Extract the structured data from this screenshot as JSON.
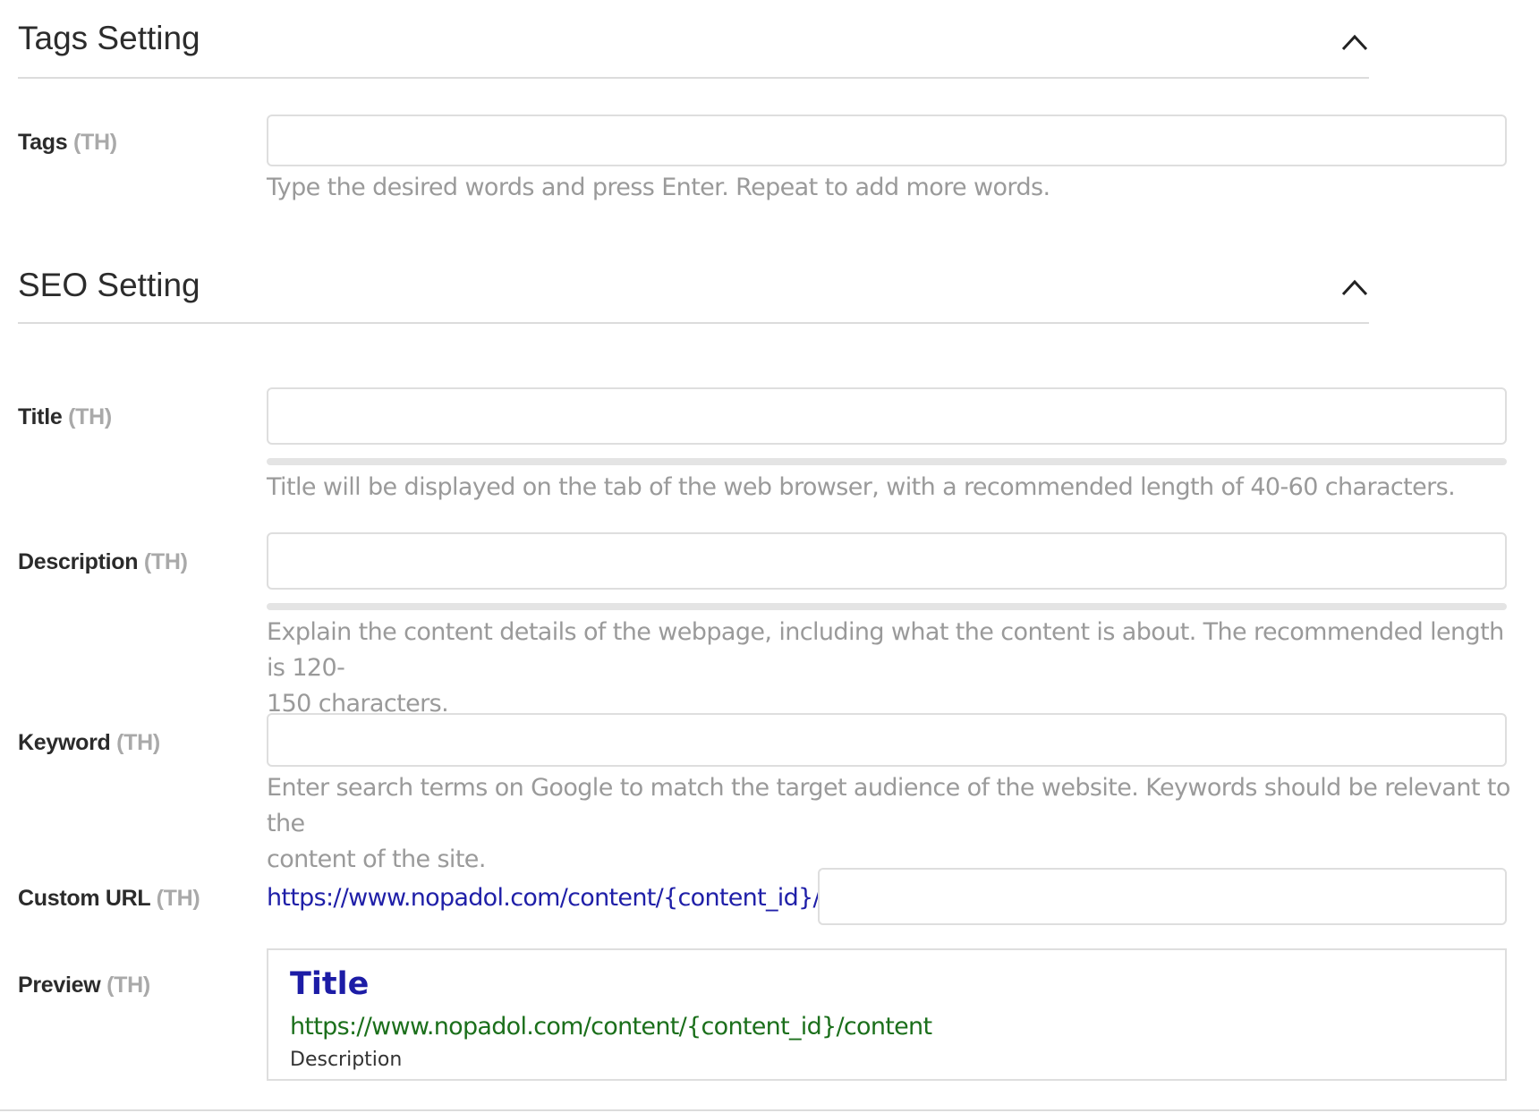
{
  "tags_section": {
    "title": "Tags Setting",
    "collapse_icon": "chevron-up-icon",
    "tags": {
      "label": "Tags",
      "lang": "(TH)",
      "value": "",
      "help": "Type the desired words and press Enter. Repeat to add more words."
    }
  },
  "seo_section": {
    "title": "SEO Setting",
    "collapse_icon": "chevron-up-icon",
    "title_field": {
      "label": "Title",
      "lang": "(TH)",
      "value": "",
      "help": "Title will be displayed on the tab of the web browser, with a recommended length of 40-60 characters."
    },
    "description_field": {
      "label": "Description",
      "lang": "(TH)",
      "value": "",
      "help_line1": "Explain the content details of the webpage, including what the content is about. The recommended length is 120-",
      "help_line2": "150 characters."
    },
    "keyword_field": {
      "label": "Keyword",
      "lang": "(TH)",
      "value": "",
      "help_line1": "Enter search terms on Google to match the target audience of the website. Keywords should be relevant to the",
      "help_line2": "content of the site."
    },
    "custom_url": {
      "label": "Custom URL",
      "lang": "(TH)",
      "prefix": "https://www.nopadol.com/content/{content_id}/",
      "value": ""
    },
    "preview": {
      "label": "Preview",
      "lang": "(TH)",
      "title": "Title",
      "url": "https://www.nopadol.com/content/{content_id}/content",
      "description": "Description"
    }
  },
  "colors": {
    "link_blue": "#1f1fa8",
    "preview_url_green": "#1b6f1b",
    "muted_gray": "#9a9a9a"
  }
}
